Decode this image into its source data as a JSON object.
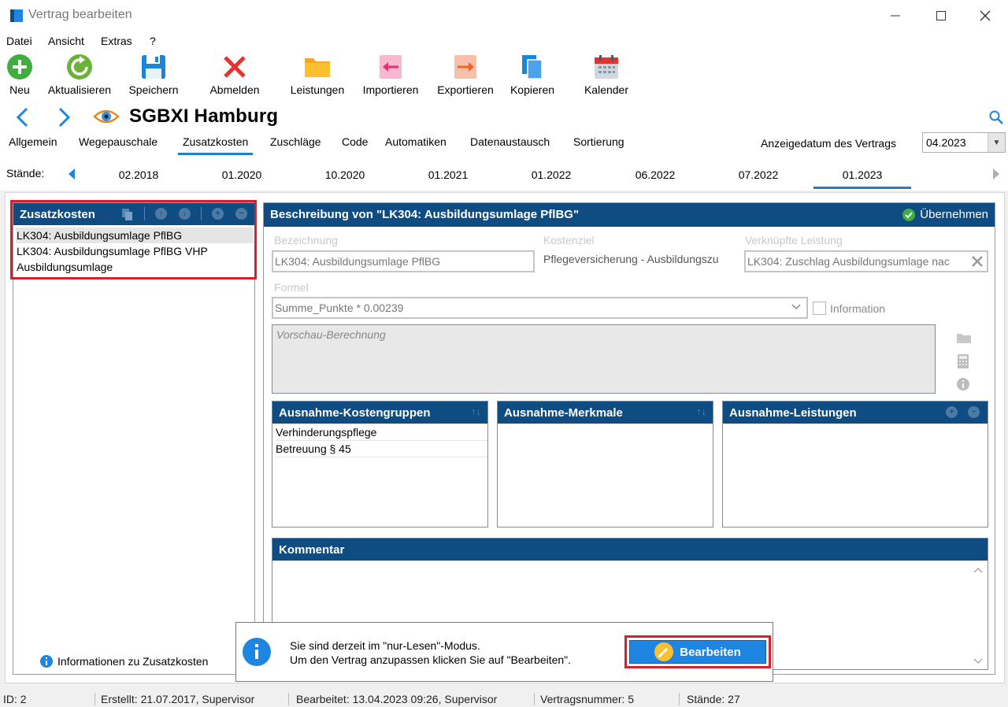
{
  "window": {
    "title": "Vertrag bearbeiten"
  },
  "menu": [
    "Datei",
    "Ansicht",
    "Extras",
    "?"
  ],
  "toolbar": {
    "neu": "Neu",
    "aktualisieren": "Aktualisieren",
    "speichern": "Speichern",
    "abmelden": "Abmelden",
    "leistungen": "Leistungen",
    "importieren": "Importieren",
    "exportieren": "Exportieren",
    "kopieren": "Kopieren",
    "kalender": "Kalender"
  },
  "nav": {
    "title": "SGBXI Hamburg"
  },
  "tabs": [
    "Allgemein",
    "Wegepauschale",
    "Zusatzkosten",
    "Zuschläge",
    "Code",
    "Automatiken",
    "Datenaustausch",
    "Sortierung"
  ],
  "active_tab": "Zusatzkosten",
  "anzeigedatum": {
    "label": "Anzeigedatum des Vertrags",
    "value": "04.2023"
  },
  "staende": {
    "label": "Stände:",
    "items": [
      "02.2018",
      "01.2020",
      "10.2020",
      "01.2021",
      "01.2022",
      "06.2022",
      "07.2022",
      "01.2023"
    ],
    "active": "01.2023"
  },
  "left_panel": {
    "title": "Zusatzkosten",
    "items": [
      "LK304: Ausbildungsumlage PflBG",
      "LK304: Ausbildungsumlage PflBG VHP",
      "Ausbildungsumlage"
    ],
    "info": "Informationen zu Zusatzkosten"
  },
  "detail": {
    "title": "Beschreibung von \"LK304: Ausbildungsumlage PflBG\"",
    "uebernehmen": "Übernehmen",
    "bezeichnung_label": "Bezeichnung",
    "bezeichnung_value": "LK304: Ausbildungsumlage PflBG",
    "kostenziel_label": "Kostenziel",
    "kostenziel_value": "Pflegeversicherung - Ausbildungszu",
    "verknuepfte_label": "Verknüpfte Leistung",
    "verknuepfte_value": "LK304: Zuschlag Ausbildungsumlage nac",
    "formel_label": "Formel",
    "formel_value": "Summe_Punkte * 0.00239",
    "information_label": "Information",
    "vorschau_placeholder": "Vorschau-Berechnung"
  },
  "ausnahme_kostengruppen": {
    "title": "Ausnahme-Kostengruppen",
    "items": [
      "Verhinderungspflege",
      "Betreuung § 45"
    ]
  },
  "ausnahme_merkmale": {
    "title": "Ausnahme-Merkmale"
  },
  "ausnahme_leistungen": {
    "title": "Ausnahme-Leistungen"
  },
  "kommentar": {
    "title": "Kommentar"
  },
  "popup": {
    "line1": "Sie sind derzeit im \"nur-Lesen\"-Modus.",
    "line2": "Um den Vertrag anzupassen klicken Sie auf \"Bearbeiten\".",
    "button": "Bearbeiten"
  },
  "status": {
    "id": "ID: 2",
    "erstellt": "Erstellt: 21.07.2017, Supervisor",
    "bearbeitet": "Bearbeitet: 13.04.2023 09:26, Supervisor",
    "vertragsnummer": "Vertragsnummer: 5",
    "staende": "Stände: 27"
  },
  "colors": {
    "header_blue": "#0f4c81",
    "accent_blue": "#1e7fd0",
    "highlight_red": "#d6202c"
  }
}
